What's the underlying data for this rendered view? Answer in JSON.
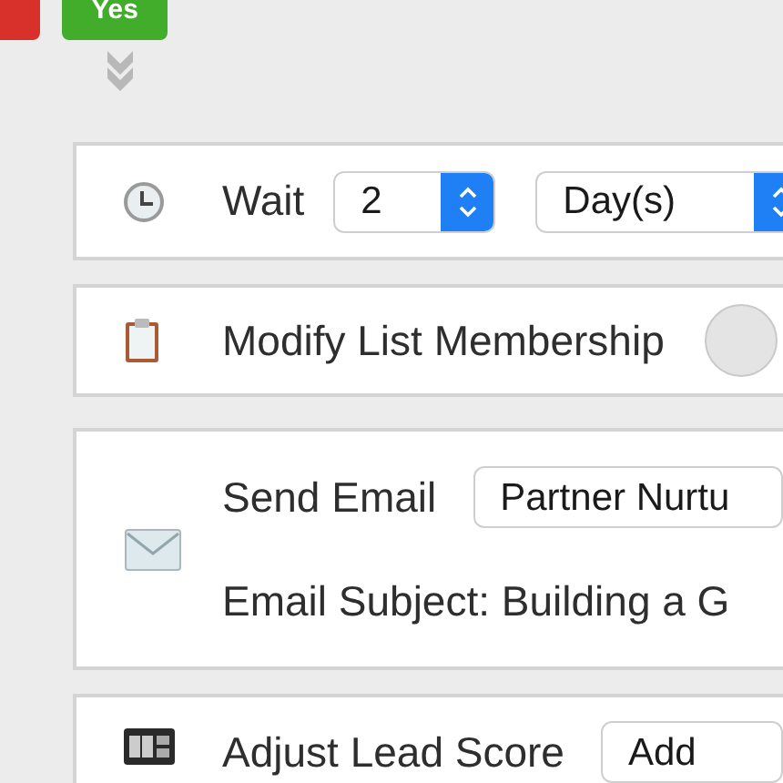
{
  "yes_button": {
    "label": "Yes"
  },
  "steps": [
    {
      "kind": "wait",
      "label": "Wait",
      "amount": "2",
      "unit": "Day(s)"
    },
    {
      "kind": "list",
      "label": "Modify List Membership"
    },
    {
      "kind": "email",
      "label": "Send Email",
      "email": "Partner Nurtu",
      "subject": "Email Subject: Building a G"
    },
    {
      "kind": "score",
      "label": "Adjust Lead Score",
      "action": "Add"
    }
  ]
}
